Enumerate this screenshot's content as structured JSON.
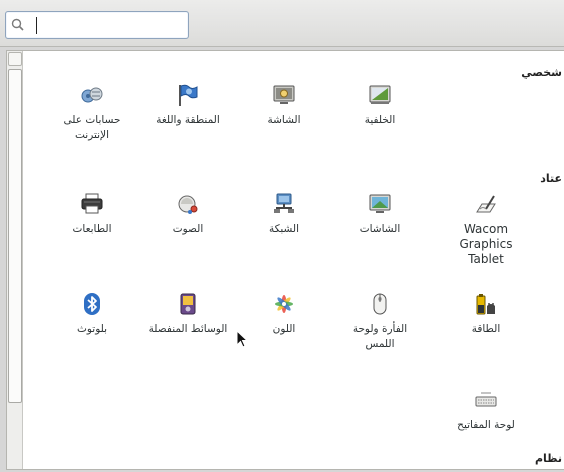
{
  "search": {
    "placeholder": "",
    "value": "",
    "icon": "search-icon"
  },
  "sections": {
    "personal": "شخصي",
    "hardware": "عتاد",
    "system": "نظام"
  },
  "items": {
    "background": "الخلفية",
    "display_lock": "الشاشة",
    "region_language": "المنطقة واللغة",
    "online_accounts": "حسابات على الإنترنت",
    "wacom": "Wacom Graphics Tablet",
    "displays": "الشاشات",
    "network": "الشبكة",
    "sound": "الصوت",
    "printers": "الطابعات",
    "power": "الطاقة",
    "mouse_touchpad": "الفأرة ولوحة اللمس",
    "color": "اللون",
    "removable_media": "الوسائط المنفصلة",
    "bluetooth": "بلوتوث",
    "keyboard": "لوحة المفاتيح"
  }
}
